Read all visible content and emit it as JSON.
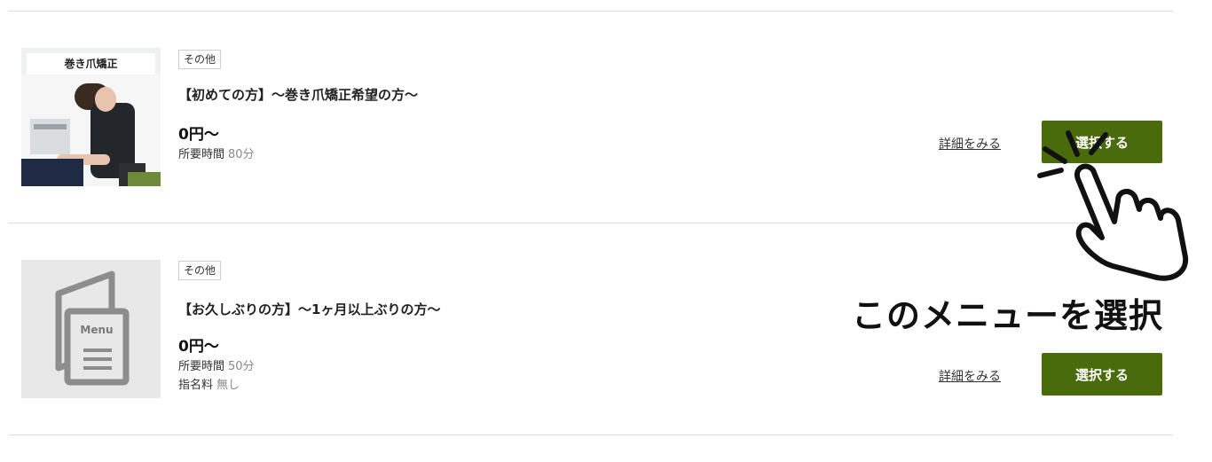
{
  "menus": [
    {
      "photo_label": "巻き爪矯正",
      "category": "その他",
      "title": "【初めての方】～巻き爪矯正希望の方～",
      "price": "0円～",
      "duration_label": "所要時間",
      "duration_value": "80分",
      "detail_link": "詳細をみる",
      "select_label": "選択する"
    },
    {
      "thumb_icon_text": "Menu",
      "category": "その他",
      "title": "【お久しぶりの方】～1ヶ月以上ぶりの方～",
      "price": "0円～",
      "duration_label": "所要時間",
      "duration_value": "50分",
      "nomination_label": "指名料",
      "nomination_value": "無し",
      "detail_link": "詳細をみる",
      "select_label": "選択する"
    }
  ],
  "callout_text": "このメニューを選択",
  "colors": {
    "accent": "#4a6b0c",
    "divider": "#dcdcdc",
    "placeholder_bg": "#e8e8e8"
  },
  "icons": [
    "menu-document-icon",
    "pointing-hand-icon"
  ]
}
